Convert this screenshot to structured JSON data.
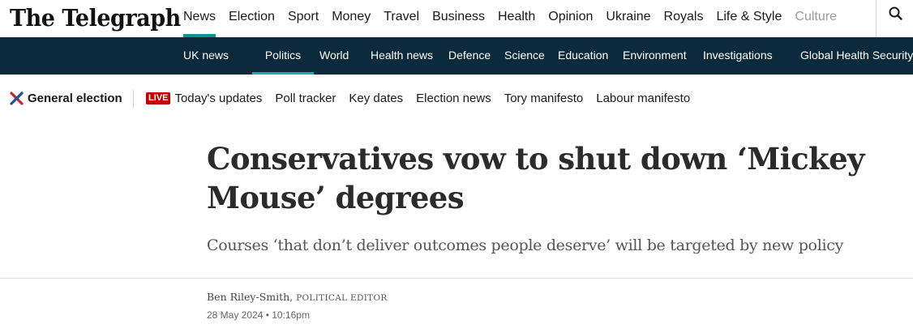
{
  "site": {
    "logo": "The Telegraph"
  },
  "primary_nav": [
    {
      "label": "News",
      "active": true
    },
    {
      "label": "Election"
    },
    {
      "label": "Sport"
    },
    {
      "label": "Money"
    },
    {
      "label": "Travel"
    },
    {
      "label": "Business"
    },
    {
      "label": "Health"
    },
    {
      "label": "Opinion"
    },
    {
      "label": "Ukraine"
    },
    {
      "label": "Royals"
    },
    {
      "label": "Life & Style"
    },
    {
      "label": "Culture"
    }
  ],
  "search": {
    "icon": "search-icon"
  },
  "sub_nav": [
    {
      "label": "UK news"
    },
    {
      "label": "Politics",
      "active": true
    },
    {
      "label": "World"
    },
    {
      "label": "Health news"
    },
    {
      "label": "Defence"
    },
    {
      "label": "Science"
    },
    {
      "label": "Education"
    },
    {
      "label": "Environment"
    },
    {
      "label": "Investigations"
    },
    {
      "label": "Global Health Security"
    }
  ],
  "election_bar": {
    "title": "General election",
    "live_badge": "LIVE",
    "links": [
      "Today's updates",
      "Poll tracker",
      "Key dates",
      "Election news",
      "Tory manifesto",
      "Labour manifesto"
    ]
  },
  "article": {
    "headline": "Conservatives vow to shut down ‘Mickey Mouse’ degrees",
    "standfirst": "Courses ‘that don’t deliver outcomes people deserve’ will be targeted by new policy",
    "author": "Ben Riley-Smith,",
    "author_role": "POLITICAL EDITOR",
    "date": "28 May 2024 • 10:16pm"
  },
  "colors": {
    "accent_teal": "#0d9494",
    "subnav_background": "#0b2a3c",
    "live_red": "#c00000",
    "election_x_red": "#d0202a",
    "election_x_blue": "#1f4ea8"
  }
}
